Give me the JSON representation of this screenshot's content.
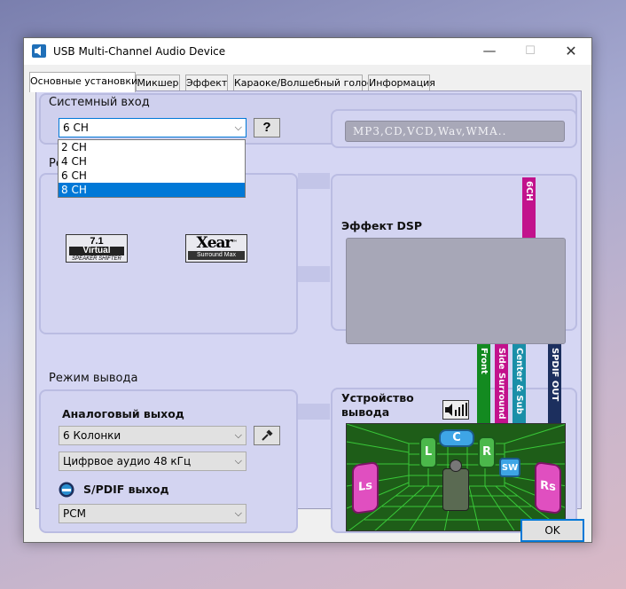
{
  "window": {
    "title": "USB Multi-Channel Audio Device",
    "minimize": "—",
    "maximize": "☐",
    "close": "✕"
  },
  "tabs": [
    {
      "label": "Основные установки",
      "active": true
    },
    {
      "label": "Микшер",
      "active": false
    },
    {
      "label": "Эффект",
      "active": false
    },
    {
      "label": "Караоке/Волшебный голос",
      "active": false
    },
    {
      "label": "Информация",
      "active": false
    }
  ],
  "system_input": {
    "heading": "Системный вход",
    "channels_value": "6 CH",
    "help_label": "?",
    "dropdown_options": [
      "2 CH",
      "4 CH",
      "6 CH",
      "8 CH"
    ],
    "highlighted_option": "8 CH",
    "display_text": "MP3,CD,VCD,Wav,WMA..",
    "partial_heading": "Ре"
  },
  "effects": {
    "virtual_logo_top": "7.1",
    "virtual_logo_mid": "Virtual",
    "virtual_logo_bottom": "SPEAKER SHIFTER",
    "xear_logo_main": "Xear",
    "xear_logo_tm": "™",
    "xear_logo_sub": "Surround Max"
  },
  "dsp": {
    "heading": "Эффект DSP",
    "band_6ch": "6CH"
  },
  "output_mode": {
    "heading": "Режим вывода",
    "analog_heading": "Аналоговый выход",
    "speakers_value": "6  Колонки",
    "digital_value": "Цифрвое аудио 48 кГц",
    "spdif_heading": "S/PDIF выход",
    "spdif_value": "PCM"
  },
  "device": {
    "heading_line1": "Устройство",
    "heading_line2": "вывода",
    "bands": [
      {
        "label": "Front",
        "color": "#138a20"
      },
      {
        "label": "Side Surround",
        "color": "#c2128c"
      },
      {
        "label": "Center & Sub",
        "color": "#1a8fa8"
      },
      {
        "label": "SPDIF OUT",
        "color": "#1c2f5e"
      }
    ],
    "speakers": {
      "front_left": "L",
      "center": "C",
      "front_right": "R",
      "subwoofer": "SW",
      "surround_left": "Ls",
      "surround_right": "Rs"
    }
  },
  "footer": {
    "ok_label": "OK"
  },
  "colors": {
    "accent": "#0078d7",
    "panel": "#d5d6f3",
    "room": "#1e5d18",
    "grid": "#3cd43c"
  }
}
